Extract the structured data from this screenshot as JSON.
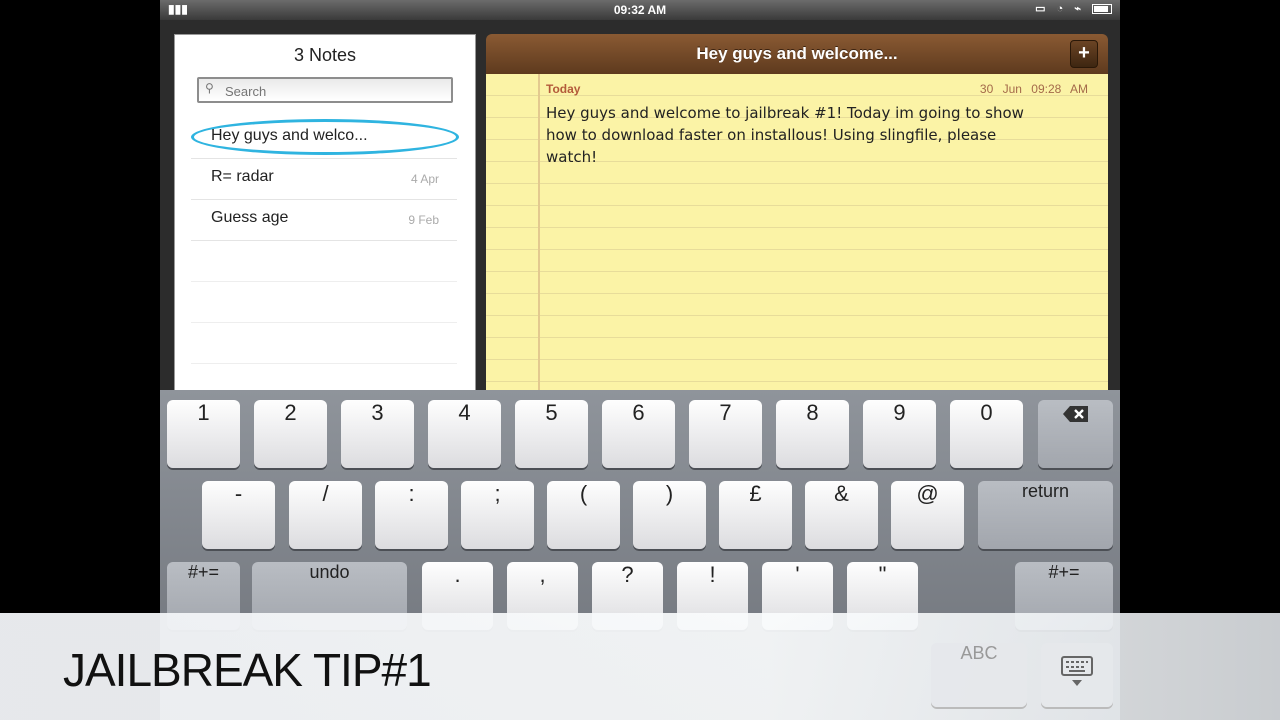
{
  "status": {
    "time": "09:32 AM"
  },
  "list": {
    "title": "3 Notes",
    "search_placeholder": "Search",
    "notes": [
      {
        "title": "Hey guys and welco...",
        "date": ""
      },
      {
        "title": "R= radar",
        "date": "4 Apr"
      },
      {
        "title": "Guess age",
        "date": "9 Feb"
      }
    ]
  },
  "note": {
    "header_title": "Hey guys and welcome...",
    "add_label": "+",
    "today_label": "Today",
    "date": "30 Jun",
    "time": "09:28 AM",
    "body": "Hey guys and welcome to jailbreak #1! Today im going to show how to download faster on installous! Using slingfile, please watch!"
  },
  "keyboard": {
    "row1": [
      "1",
      "2",
      "3",
      "4",
      "5",
      "6",
      "7",
      "8",
      "9",
      "0"
    ],
    "row2": [
      "-",
      "/",
      ":",
      ";",
      "(",
      ")",
      "£",
      "&",
      "@"
    ],
    "return_label": "return",
    "row3": [
      ".",
      ",",
      "?",
      "!",
      "'",
      "\""
    ],
    "symbols_label": "#+=",
    "undo_label": "undo",
    "abc_label": "ABC",
    "backspace_icon": "backspace-icon",
    "keyboard_icon": "keyboard-dismiss-icon"
  },
  "banner": {
    "text": "JAILBREAK TIP#1"
  }
}
